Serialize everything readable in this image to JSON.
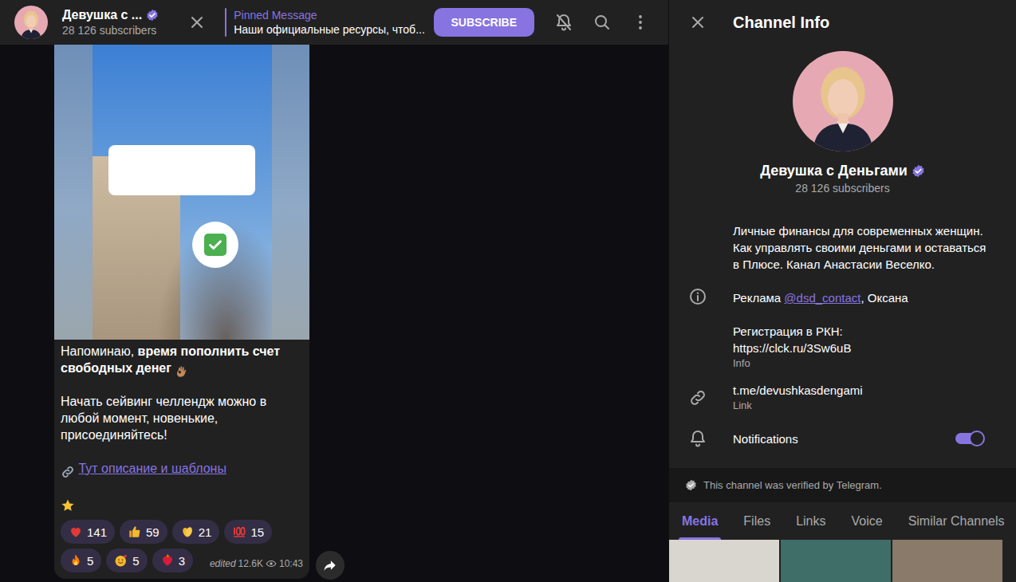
{
  "header": {
    "title": "Девушка с ...",
    "verified": true,
    "subscribers": "28 126 subscribers",
    "pinned": {
      "label": "Pinned Message",
      "text": "Наши официальные ресурсы, чтоб..."
    },
    "subscribe": "SUBSCRIBE",
    "muted": true
  },
  "message": {
    "text_plain": "Напоминаю, ",
    "text_bold": "время пополнить счет свободных денег",
    "paragraph2": "Начать сейвинг челлендж можно в любой момент, новенькие, присоединяйтесь!",
    "link_text": "Тут описание и шаблоны",
    "reactions": [
      {
        "kind": "heart",
        "count": "141"
      },
      {
        "kind": "like",
        "count": "59"
      },
      {
        "kind": "clap",
        "count": "21"
      },
      {
        "kind": "hundred",
        "count": "15"
      },
      {
        "kind": "fire",
        "count": "5"
      },
      {
        "kind": "love",
        "count": "5"
      },
      {
        "kind": "heartfire",
        "count": "3"
      }
    ],
    "edited": "edited",
    "views": "12.6K",
    "time": "10:43"
  },
  "channel_info": {
    "title": "Channel Info",
    "name": "Девушка с Деньгами",
    "verified": true,
    "subscribers": "28 126 subscribers",
    "description": {
      "about": "Личные финансы для современных женщин. Как управлять своими деньгами и оставаться в Плюсе. Канал Анастасии Веселко.",
      "ad_prefix": "Реклама ",
      "ad_handle": "@dsd_contact",
      "ad_suffix": ", Оксана",
      "rkn_label": "Регистрация в РКН:",
      "rkn_url": "https://clck.ru/3Sw6uB",
      "caption": "Info"
    },
    "link": {
      "url": "t.me/devushkasdengami",
      "caption": "Link"
    },
    "notifications": {
      "label": "Notifications",
      "on": true
    },
    "verified_note": "This channel was verified by Telegram.",
    "tabs": [
      {
        "label": "Media",
        "selected": true
      },
      {
        "label": "Files",
        "selected": false
      },
      {
        "label": "Links",
        "selected": false
      },
      {
        "label": "Voice",
        "selected": false
      },
      {
        "label": "Similar Channels",
        "selected": false
      }
    ]
  }
}
